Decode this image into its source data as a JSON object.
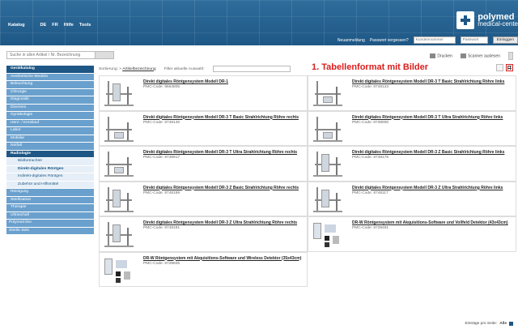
{
  "topnav": {
    "items": [
      "Katalog",
      "DE",
      "FR",
      "Hilfe",
      "Tools"
    ]
  },
  "logo": {
    "line1": "polymed",
    "line2": "medical-cente"
  },
  "login": {
    "register": "Neuanmeldung",
    "forgot": "Passwort vergessen?",
    "customer_placeholder": "Kundennummer",
    "password_placeholder": "Passwort",
    "login_button": "Einloggen"
  },
  "search": {
    "placeholder": "Suche in allen Artikel / Nr. Bezeichnung"
  },
  "actions": {
    "print": "Drucken",
    "scanner": "Scanner auslesen"
  },
  "sidebar": {
    "header": "Gerätkatalog",
    "items": [
      {
        "label": "Aesthetische Medizin",
        "type": "normal"
      },
      {
        "label": "Beleuchtung",
        "type": "normal"
      },
      {
        "label": "Chirurgie",
        "type": "normal"
      },
      {
        "label": "Diagnostik",
        "type": "normal"
      },
      {
        "label": "Diverses",
        "type": "normal"
      },
      {
        "label": "Gynäkologie",
        "type": "normal"
      },
      {
        "label": "Herz- / Kreislauf",
        "type": "normal"
      },
      {
        "label": "Labor",
        "type": "normal"
      },
      {
        "label": "Mobiliar",
        "type": "normal"
      },
      {
        "label": "Notfall",
        "type": "normal"
      },
      {
        "label": "Radiologie",
        "type": "active"
      },
      {
        "label": "Bildbetrachter",
        "type": "sub"
      },
      {
        "label": "Direkt-digitales Röntgen",
        "type": "subcur"
      },
      {
        "label": "Indirekt-digitales Röntgen",
        "type": "sub"
      },
      {
        "label": "Zubehör und Hilfsmittel",
        "type": "sub"
      },
      {
        "label": "Reinigung",
        "type": "normal"
      },
      {
        "label": "Sterilisation",
        "type": "normal"
      },
      {
        "label": "Therapie",
        "type": "normal"
      },
      {
        "label": "Ultraschall",
        "type": "normal"
      },
      {
        "label": "Polymed line",
        "type": "root"
      },
      {
        "label": "Sterile Sets",
        "type": "root"
      }
    ]
  },
  "toolbar": {
    "sort_label": "Sortierung: >",
    "sort_value": "Artikelbezeichnung",
    "filter_label": "Filter aktuelle Auswahl:"
  },
  "note": "1. Tabellenformat mit Bilder",
  "products": [
    {
      "title": "Direkt digitales Röntgensystem Modell DR-1",
      "code": "PMC-Code: 8664805",
      "img": "variant2"
    },
    {
      "title": "Direkt digitales Röntgensystem Modell DR-3 T Basic Strahlrichtung Röhre links",
      "code": "PMC-Code: 8748123",
      "img": "normal"
    },
    {
      "title": "Direkt digitales Röntgensystem Modell DR-3 T Basic Strahlrichtung Röhre rechts",
      "code": "PMC-Code: 8748146",
      "img": "normal"
    },
    {
      "title": "Direkt digitales Röntgensystem Modell DR-3 T Ultra Strahlrichtung Röhre links",
      "code": "PMC-Code: 8738900",
      "img": "normal"
    },
    {
      "title": "Direkt digitales Röntgensystem Modell DR-3 T Ultra Strahlrichtung Röhre rechts",
      "code": "PMC-Code: 8738917",
      "img": "normal"
    },
    {
      "title": "Direkt digitales Röntgensystem Modell DR-3 Z Basic Strahlrichtung Röhre links",
      "code": "PMC-Code: 8748175",
      "img": "variant2"
    },
    {
      "title": "Direkt digitales Röntgensystem Modell DR-3 Z Basic Strahlrichtung Röhre rechts",
      "code": "PMC-Code: 8748169",
      "img": "variant2"
    },
    {
      "title": "Direkt digitales Röntgensystem Modell DR-3 Z Ultra Strahlrichtung Röhre links",
      "code": "PMC-Code: 8748117",
      "img": "variant2"
    },
    {
      "title": "Direkt digitales Röntgensystem Modell DR-3 Z Ultra Strahlrichtung Röhre rechts",
      "code": "PMC-Code: 8748181",
      "img": "variant2"
    },
    {
      "title": "DR-W Röntgensystem mit Akquisitions-Software und Vollfeld Detektor (43x43cm)",
      "code": "PMC-Code: 8729491",
      "img": "kit"
    },
    {
      "title": "DR-W Röntgensystem mit Akquisitions-Software und Wireless Detektor (35x43cm)",
      "code": "PMC-Code: 8729605",
      "img": "kit"
    }
  ],
  "footer": {
    "label": "Einträge pro Seite:",
    "value": "Alle"
  }
}
